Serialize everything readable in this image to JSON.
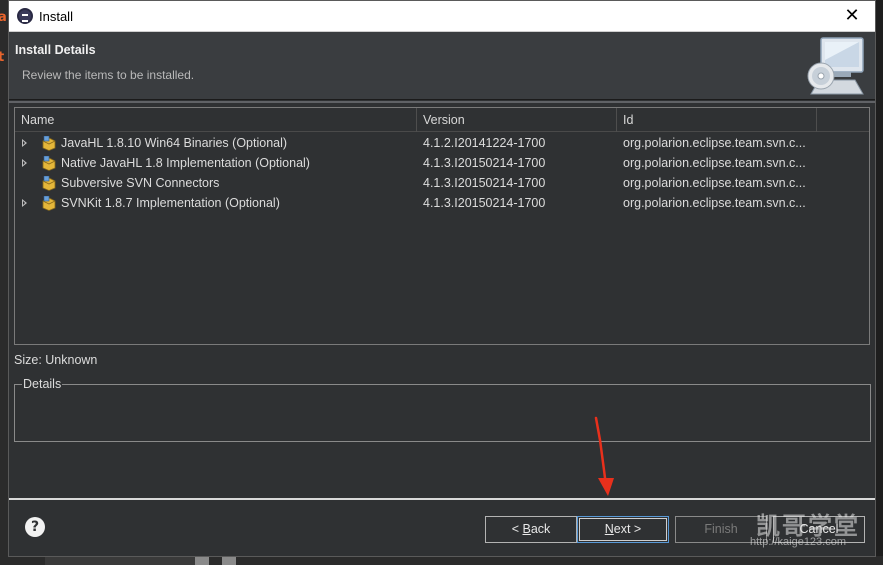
{
  "window": {
    "title": "Install",
    "close_glyph": "✕"
  },
  "header": {
    "title": "Install Details",
    "subtitle": "Review the items to be installed."
  },
  "table": {
    "columns": [
      "Name",
      "Version",
      "Id"
    ],
    "rows": [
      {
        "name": "JavaHL 1.8.10 Win64 Binaries (Optional)",
        "version": "4.1.2.I20141224-1700",
        "id": "org.polarion.eclipse.team.svn.c...",
        "expandable": true,
        "icon": "package-icon"
      },
      {
        "name": "Native JavaHL 1.8 Implementation (Optional)",
        "version": "4.1.3.I20150214-1700",
        "id": "org.polarion.eclipse.team.svn.c...",
        "expandable": true,
        "icon": "package-icon"
      },
      {
        "name": "Subversive SVN Connectors",
        "version": "4.1.3.I20150214-1700",
        "id": "org.polarion.eclipse.team.svn.c...",
        "expandable": false,
        "icon": "package-icon"
      },
      {
        "name": "SVNKit 1.8.7 Implementation (Optional)",
        "version": "4.1.3.I20150214-1700",
        "id": "org.polarion.eclipse.team.svn.c...",
        "expandable": true,
        "icon": "package-icon"
      }
    ]
  },
  "size_label": "Size: Unknown",
  "details_label": "Details",
  "buttons": {
    "help": "?",
    "back_prefix": "< ",
    "back_mnemonic": "B",
    "back_rest": "ack",
    "next_mnemonic": "N",
    "next_rest": "ext >",
    "finish": "Finish",
    "cancel": "Cancel"
  },
  "watermark": {
    "text": "凯哥学堂",
    "url": "http://kaige123.com"
  },
  "background_fragments": [
    "a",
    "t"
  ],
  "colors": {
    "dialog_bg": "#2f3133",
    "header_bg": "#3a3d40",
    "annotation_arrow": "#e8301c",
    "focus_border": "#5a9ad8"
  }
}
